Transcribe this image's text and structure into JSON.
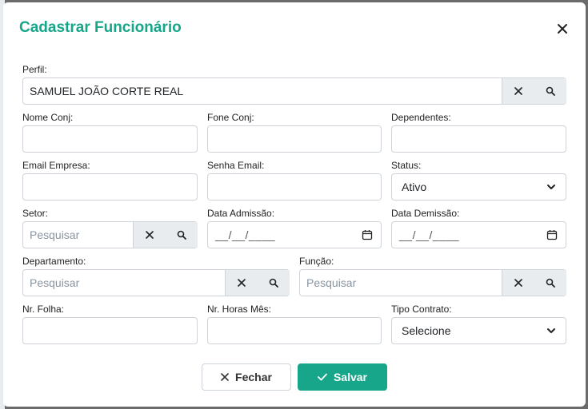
{
  "modal": {
    "title": "Cadastrar Funcionário"
  },
  "fields": {
    "perfil": {
      "label": "Perfil:",
      "value": "SAMUEL JOÃO CORTE REAL"
    },
    "nome_conj": {
      "label": "Nome Conj:",
      "value": ""
    },
    "fone_conj": {
      "label": "Fone Conj:",
      "value": ""
    },
    "dependentes": {
      "label": "Dependentes:",
      "value": ""
    },
    "email_empresa": {
      "label": "Email Empresa:",
      "value": ""
    },
    "senha_email": {
      "label": "Senha Email:",
      "value": ""
    },
    "status": {
      "label": "Status:",
      "selected": "Ativo"
    },
    "setor": {
      "label": "Setor:",
      "placeholder": "Pesquisar"
    },
    "data_admissao": {
      "label": "Data Admissão:",
      "placeholder": "__/__/____"
    },
    "data_demissao": {
      "label": "Data Demissão:",
      "placeholder": "__/__/____"
    },
    "departamento": {
      "label": "Departamento:",
      "placeholder": "Pesquisar"
    },
    "funcao": {
      "label": "Função:",
      "placeholder": "Pesquisar"
    },
    "nr_folha": {
      "label": "Nr. Folha:",
      "value": ""
    },
    "nr_horas_mes": {
      "label": "Nr. Horas Mês:",
      "value": ""
    },
    "tipo_contrato": {
      "label": "Tipo Contrato:",
      "selected": "Selecione"
    }
  },
  "buttons": {
    "close_label": "Fechar",
    "save_label": "Salvar"
  },
  "colors": {
    "accent": "#17a689",
    "addon_bg": "#e9ecef",
    "border": "#ced4da"
  },
  "icons": {
    "close": "close-icon",
    "clear": "clear-icon",
    "search": "search-icon",
    "chevron": "chevron-down-icon",
    "calendar": "calendar-icon",
    "check": "check-icon"
  }
}
